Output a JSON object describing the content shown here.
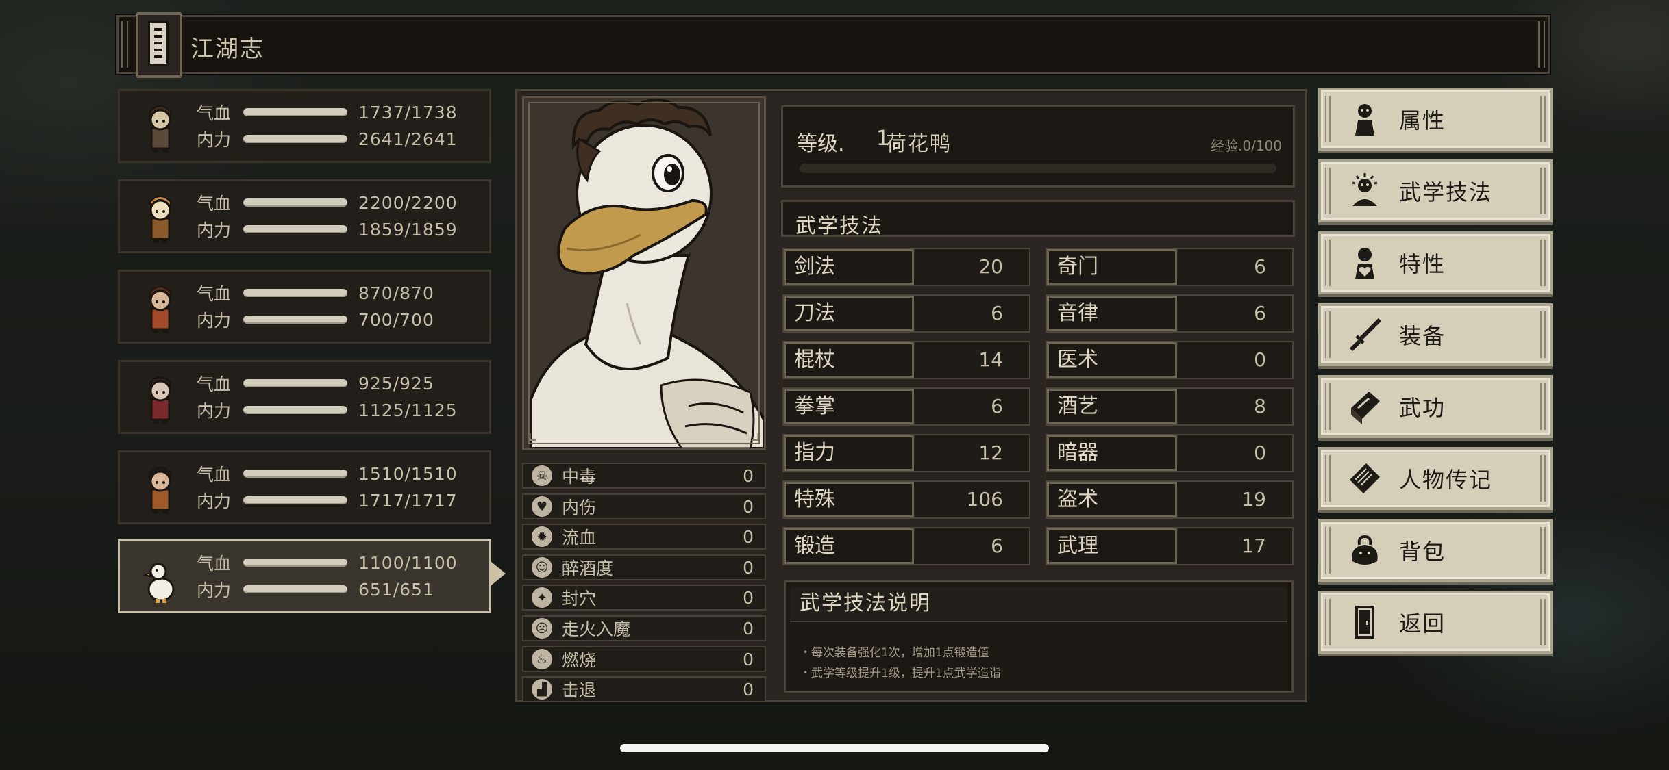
{
  "header": {
    "title": "江湖志"
  },
  "party": [
    {
      "hp_label": "气血",
      "hp": "1737/1738",
      "mp_label": "内力",
      "mp": "2641/2641",
      "selected": false
    },
    {
      "hp_label": "气血",
      "hp": "2200/2200",
      "mp_label": "内力",
      "mp": "1859/1859",
      "selected": false
    },
    {
      "hp_label": "气血",
      "hp": "870/870",
      "mp_label": "内力",
      "mp": "700/700",
      "selected": false
    },
    {
      "hp_label": "气血",
      "hp": "925/925",
      "mp_label": "内力",
      "mp": "1125/1125",
      "selected": false
    },
    {
      "hp_label": "气血",
      "hp": "1510/1510",
      "mp_label": "内力",
      "mp": "1717/1717",
      "selected": false
    },
    {
      "hp_label": "气血",
      "hp": "1100/1100",
      "mp_label": "内力",
      "mp": "651/651",
      "selected": true
    }
  ],
  "character": {
    "level_label": "等级.",
    "level": "1",
    "name": "荷花鸭",
    "exp_text": "经验.0/100",
    "exp_progress": 0
  },
  "status_effects": [
    {
      "name": "中毒",
      "value": "0",
      "icon": "skull-icon"
    },
    {
      "name": "内伤",
      "value": "0",
      "icon": "broken-heart-icon"
    },
    {
      "name": "流血",
      "value": "0",
      "icon": "blood-splat-icon"
    },
    {
      "name": "醉酒度",
      "value": "0",
      "icon": "dizzy-icon"
    },
    {
      "name": "封穴",
      "value": "0",
      "icon": "pressure-point-icon"
    },
    {
      "name": "走火入魔",
      "value": "0",
      "icon": "demon-face-icon"
    },
    {
      "name": "燃烧",
      "value": "0",
      "icon": "flame-icon"
    },
    {
      "name": "击退",
      "value": "0",
      "icon": "boot-icon"
    }
  ],
  "skills_section": {
    "title": "武学技法",
    "skills": [
      {
        "name": "剑法",
        "value": "20"
      },
      {
        "name": "奇门",
        "value": "6"
      },
      {
        "name": "刀法",
        "value": "6"
      },
      {
        "name": "音律",
        "value": "6"
      },
      {
        "name": "棍杖",
        "value": "14"
      },
      {
        "name": "医术",
        "value": "0"
      },
      {
        "name": "拳掌",
        "value": "6"
      },
      {
        "name": "酒艺",
        "value": "8"
      },
      {
        "name": "指力",
        "value": "12"
      },
      {
        "name": "暗器",
        "value": "0"
      },
      {
        "name": "特殊",
        "value": "106"
      },
      {
        "name": "盗术",
        "value": "19"
      },
      {
        "name": "锻造",
        "value": "6"
      },
      {
        "name": "武理",
        "value": "17"
      }
    ]
  },
  "description": {
    "title": "武学技法说明",
    "lines": [
      "・每次装备强化1次，增加1点锻造值",
      "・武学等级提升1级，提升1点武学造诣"
    ]
  },
  "menu": [
    {
      "label": "属性",
      "icon": "person-icon"
    },
    {
      "label": "武学技法",
      "icon": "meditating-person-icon"
    },
    {
      "label": "特性",
      "icon": "person-heart-icon"
    },
    {
      "label": "装备",
      "icon": "sword-icon"
    },
    {
      "label": "武功",
      "icon": "scroll-book-icon"
    },
    {
      "label": "人物传记",
      "icon": "biography-book-icon"
    },
    {
      "label": "背包",
      "icon": "bag-icon"
    },
    {
      "label": "返回",
      "icon": "door-icon"
    }
  ]
}
